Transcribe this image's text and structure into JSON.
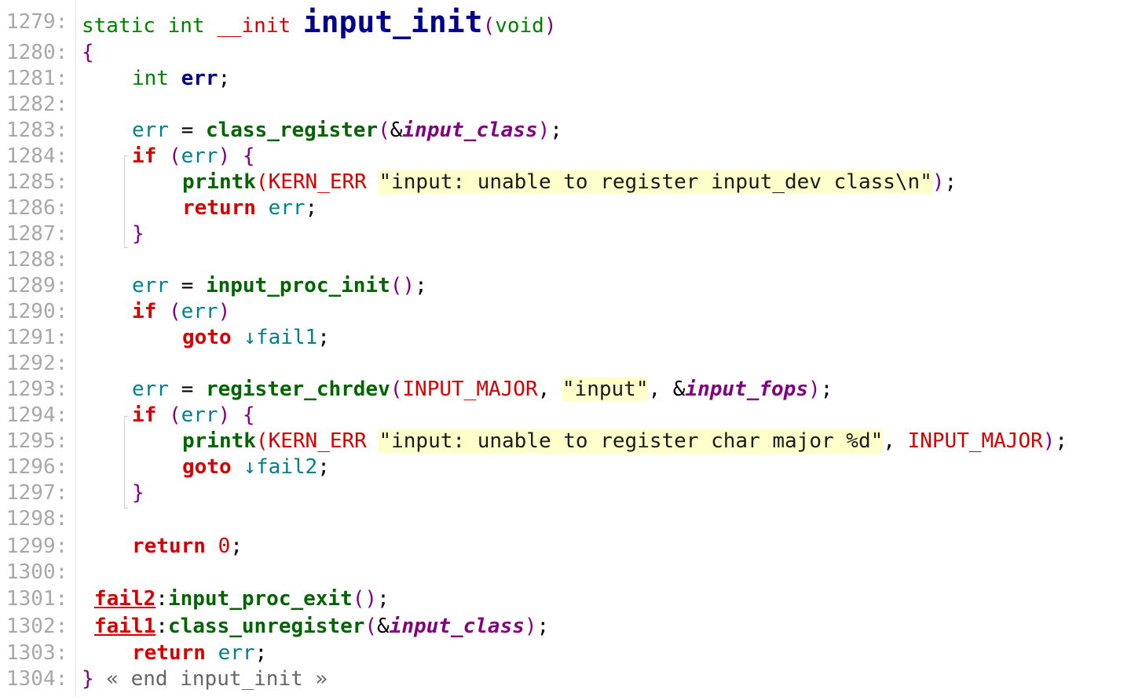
{
  "editor": {
    "lines": [
      {
        "n": "1279:"
      },
      {
        "n": "1280:"
      },
      {
        "n": "1281:"
      },
      {
        "n": "1282:"
      },
      {
        "n": "1283:"
      },
      {
        "n": "1284:"
      },
      {
        "n": "1285:"
      },
      {
        "n": "1286:"
      },
      {
        "n": "1287:"
      },
      {
        "n": "1288:"
      },
      {
        "n": "1289:"
      },
      {
        "n": "1290:"
      },
      {
        "n": "1291:"
      },
      {
        "n": "1292:"
      },
      {
        "n": "1293:"
      },
      {
        "n": "1294:"
      },
      {
        "n": "1295:"
      },
      {
        "n": "1296:"
      },
      {
        "n": "1297:"
      },
      {
        "n": "1298:"
      },
      {
        "n": "1299:"
      },
      {
        "n": "1300:"
      },
      {
        "n": "1301:"
      },
      {
        "n": "1302:"
      },
      {
        "n": "1303:"
      },
      {
        "n": "1304:"
      }
    ],
    "tokens": {
      "static": "static",
      "int": "int",
      "init_macro": "__init",
      "func_name": "input_init",
      "void": "void",
      "lparen": "(",
      "rparen": ")",
      "lbrace": "{",
      "rbrace": "}",
      "semi": ";",
      "err": "err",
      "eq": " = ",
      "class_register": "class_register",
      "amp": "&",
      "input_class": "input_class",
      "if": "if",
      "printk": "printk",
      "kern_err": "KERN_ERR",
      "str1": "\"input: unable to register input_dev class\\n\"",
      "return": "return",
      "input_proc_init": "input_proc_init",
      "empty_parens": "()",
      "goto": "goto",
      "arrow": "↓",
      "fail1": "fail1",
      "fail2": "fail2",
      "register_chrdev": "register_chrdev",
      "input_major": "INPUT_MAJOR",
      "comma": ", ",
      "str_input": "\"input\"",
      "input_fops": "input_fops",
      "str2": "\"input: unable to register char major %d\"",
      "zero": "0",
      "colon": ":",
      "input_proc_exit": "input_proc_exit",
      "class_unregister": "class_unregister",
      "end_comment": " « end input_init »"
    }
  }
}
